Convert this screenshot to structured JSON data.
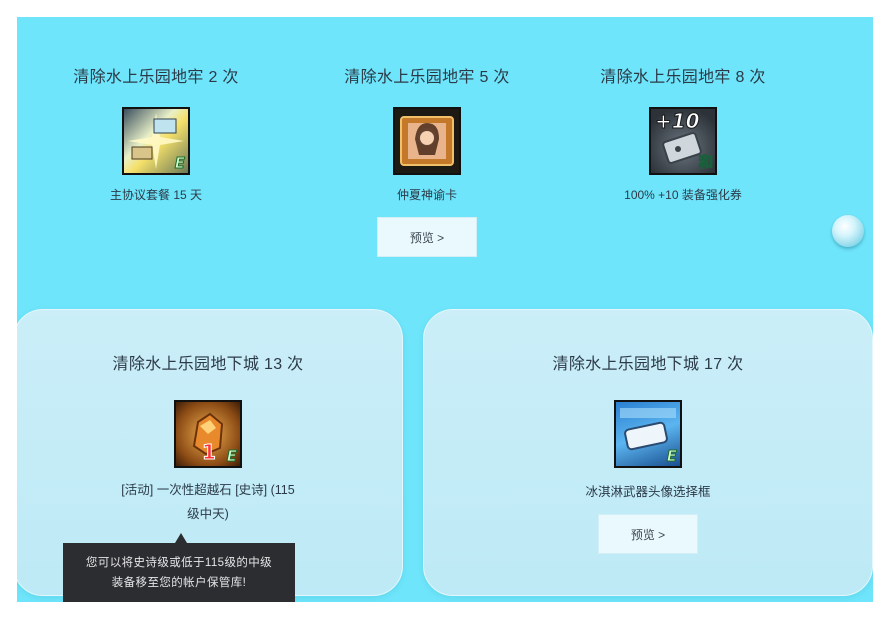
{
  "rewards_top": [
    {
      "title": "清除水上乐园地牢 2 次",
      "item": "主协议套餐 15 天",
      "icon": "protocol-package-icon",
      "badge": "E"
    },
    {
      "title": "清除水上乐园地牢 5 次",
      "item": "仲夏神谕卡",
      "icon": "oracle-card-icon",
      "preview": "预览 >"
    },
    {
      "title": "清除水上乐园地牢 8 次",
      "item": "100% +10 装备强化券",
      "icon": "enhance-ticket-icon",
      "overlay": "+10",
      "badge": "和"
    }
  ],
  "rewards_bottom": [
    {
      "title": "清除水上乐园地下城 13 次",
      "item_line1": "[活动] 一次性超越石 [史诗] (115",
      "item_line2": "级中天)",
      "icon": "transcendence-stone-icon",
      "badge_num": "1",
      "badge": "E"
    },
    {
      "title": "清除水上乐园地下城 17 次",
      "item": "冰淇淋武器头像选择框",
      "icon": "ice-cream-frame-icon",
      "badge": "E",
      "preview": "预览 >"
    }
  ],
  "tooltip": {
    "line1": "您可以将史诗级或低于115级的中级",
    "line2": "装备移至您的帐户保管库!"
  },
  "colors": {
    "panel": "#6ee5fa",
    "card": "#c4ecf7",
    "tooltip": "#2b2d31"
  }
}
